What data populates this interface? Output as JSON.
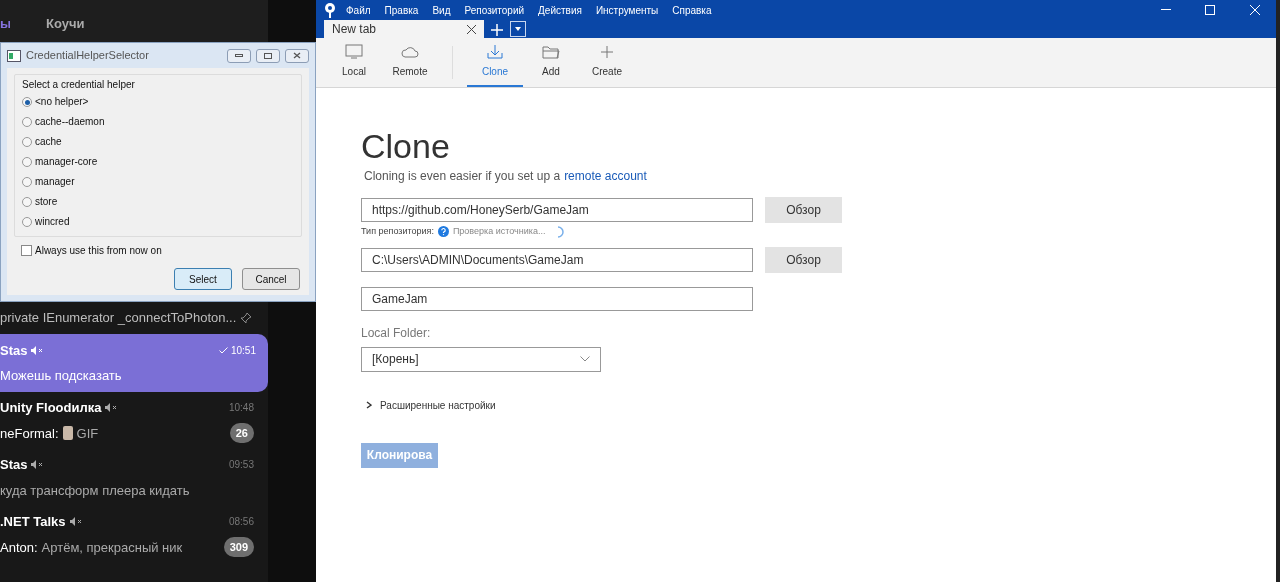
{
  "telegram": {
    "tabs": [
      {
        "label": "ы",
        "selected": true
      },
      {
        "label": "Коучи",
        "selected": false
      }
    ],
    "pinned_message": "private IEnumerator _connectToPhoton...",
    "chats": [
      {
        "name": "Stas",
        "muted": true,
        "time": "10:51",
        "read": true,
        "preview": "Можешь подсказать",
        "gif": false,
        "selected": true
      },
      {
        "name": "Unity Floodилка",
        "muted": true,
        "time": "10:48",
        "read": false,
        "sender": "neFormal:",
        "preview": "GIF",
        "gif": true,
        "badge": "26",
        "selected": false
      },
      {
        "name": "Stas",
        "muted": true,
        "time": "09:53",
        "read": false,
        "preview": "куда трансформ плеера кидать",
        "gif": false,
        "selected": false
      },
      {
        "name": ".NET Talks",
        "muted": true,
        "time": "08:56",
        "read": false,
        "sender": "Anton:",
        "preview": "Артём, прекрасный ник",
        "gif": false,
        "badge": "309",
        "selected": false
      }
    ]
  },
  "dialog": {
    "title": "CredentialHelperSelector",
    "group_label": "Select a credential helper",
    "options": [
      {
        "label": "<no helper>",
        "selected": true
      },
      {
        "label": "cache--daemon",
        "selected": false
      },
      {
        "label": "cache",
        "selected": false
      },
      {
        "label": "manager-core",
        "selected": false
      },
      {
        "label": "manager",
        "selected": false
      },
      {
        "label": "store",
        "selected": false
      },
      {
        "label": "wincred",
        "selected": false
      }
    ],
    "remember": {
      "label": "Always use this from now on",
      "checked": false
    },
    "buttons": [
      {
        "label": "Select",
        "default": true
      },
      {
        "label": "Cancel",
        "default": false
      }
    ]
  },
  "app": {
    "menu": [
      "Файл",
      "Правка",
      "Вид",
      "Репозиторий",
      "Действия",
      "Инструменты",
      "Справка"
    ],
    "tab": {
      "title": "New tab"
    },
    "toolbar": [
      {
        "kind": "local",
        "label": "Local",
        "selected": false
      },
      {
        "kind": "remote",
        "label": "Remote",
        "selected": false
      },
      {
        "kind": "clone",
        "label": "Clone",
        "selected": true
      },
      {
        "kind": "add",
        "label": "Add",
        "selected": false
      },
      {
        "kind": "create",
        "label": "Create",
        "selected": false
      }
    ],
    "heading": "Clone",
    "subtitle": "Cloning is even easier if you set up a",
    "subtitle_link": "remote account",
    "source": {
      "value": "https://github.com/HoneySerb/GameJam",
      "browse": "Обзор",
      "type_label": "Тип репозитория:",
      "status": "Проверка источника..."
    },
    "destination": {
      "value": "C:\\Users\\ADMIN\\Documents\\GameJam",
      "browse": "Обзор"
    },
    "name": {
      "value": "GameJam"
    },
    "local_folder": {
      "label": "Local Folder:",
      "value": "[Корень]"
    },
    "advanced": {
      "label": "Расширенные настройки",
      "expanded": false
    },
    "clone_button": {
      "label": "Клонирова",
      "disabled": true
    }
  }
}
